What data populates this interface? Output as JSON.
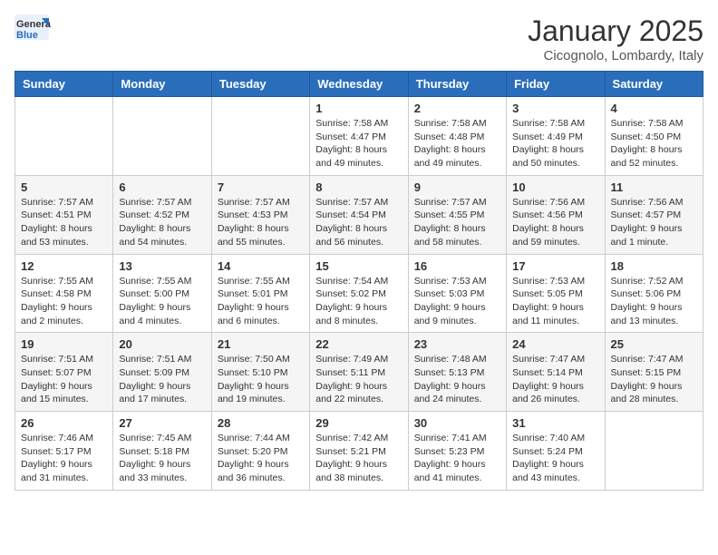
{
  "header": {
    "logo_general": "General",
    "logo_blue": "Blue",
    "month": "January 2025",
    "location": "Cicognolo, Lombardy, Italy"
  },
  "days_of_week": [
    "Sunday",
    "Monday",
    "Tuesday",
    "Wednesday",
    "Thursday",
    "Friday",
    "Saturday"
  ],
  "weeks": [
    [
      {
        "day": "",
        "info": ""
      },
      {
        "day": "",
        "info": ""
      },
      {
        "day": "",
        "info": ""
      },
      {
        "day": "1",
        "info": "Sunrise: 7:58 AM\nSunset: 4:47 PM\nDaylight: 8 hours\nand 49 minutes."
      },
      {
        "day": "2",
        "info": "Sunrise: 7:58 AM\nSunset: 4:48 PM\nDaylight: 8 hours\nand 49 minutes."
      },
      {
        "day": "3",
        "info": "Sunrise: 7:58 AM\nSunset: 4:49 PM\nDaylight: 8 hours\nand 50 minutes."
      },
      {
        "day": "4",
        "info": "Sunrise: 7:58 AM\nSunset: 4:50 PM\nDaylight: 8 hours\nand 52 minutes."
      }
    ],
    [
      {
        "day": "5",
        "info": "Sunrise: 7:57 AM\nSunset: 4:51 PM\nDaylight: 8 hours\nand 53 minutes."
      },
      {
        "day": "6",
        "info": "Sunrise: 7:57 AM\nSunset: 4:52 PM\nDaylight: 8 hours\nand 54 minutes."
      },
      {
        "day": "7",
        "info": "Sunrise: 7:57 AM\nSunset: 4:53 PM\nDaylight: 8 hours\nand 55 minutes."
      },
      {
        "day": "8",
        "info": "Sunrise: 7:57 AM\nSunset: 4:54 PM\nDaylight: 8 hours\nand 56 minutes."
      },
      {
        "day": "9",
        "info": "Sunrise: 7:57 AM\nSunset: 4:55 PM\nDaylight: 8 hours\nand 58 minutes."
      },
      {
        "day": "10",
        "info": "Sunrise: 7:56 AM\nSunset: 4:56 PM\nDaylight: 8 hours\nand 59 minutes."
      },
      {
        "day": "11",
        "info": "Sunrise: 7:56 AM\nSunset: 4:57 PM\nDaylight: 9 hours\nand 1 minute."
      }
    ],
    [
      {
        "day": "12",
        "info": "Sunrise: 7:55 AM\nSunset: 4:58 PM\nDaylight: 9 hours\nand 2 minutes."
      },
      {
        "day": "13",
        "info": "Sunrise: 7:55 AM\nSunset: 5:00 PM\nDaylight: 9 hours\nand 4 minutes."
      },
      {
        "day": "14",
        "info": "Sunrise: 7:55 AM\nSunset: 5:01 PM\nDaylight: 9 hours\nand 6 minutes."
      },
      {
        "day": "15",
        "info": "Sunrise: 7:54 AM\nSunset: 5:02 PM\nDaylight: 9 hours\nand 8 minutes."
      },
      {
        "day": "16",
        "info": "Sunrise: 7:53 AM\nSunset: 5:03 PM\nDaylight: 9 hours\nand 9 minutes."
      },
      {
        "day": "17",
        "info": "Sunrise: 7:53 AM\nSunset: 5:05 PM\nDaylight: 9 hours\nand 11 minutes."
      },
      {
        "day": "18",
        "info": "Sunrise: 7:52 AM\nSunset: 5:06 PM\nDaylight: 9 hours\nand 13 minutes."
      }
    ],
    [
      {
        "day": "19",
        "info": "Sunrise: 7:51 AM\nSunset: 5:07 PM\nDaylight: 9 hours\nand 15 minutes."
      },
      {
        "day": "20",
        "info": "Sunrise: 7:51 AM\nSunset: 5:09 PM\nDaylight: 9 hours\nand 17 minutes."
      },
      {
        "day": "21",
        "info": "Sunrise: 7:50 AM\nSunset: 5:10 PM\nDaylight: 9 hours\nand 19 minutes."
      },
      {
        "day": "22",
        "info": "Sunrise: 7:49 AM\nSunset: 5:11 PM\nDaylight: 9 hours\nand 22 minutes."
      },
      {
        "day": "23",
        "info": "Sunrise: 7:48 AM\nSunset: 5:13 PM\nDaylight: 9 hours\nand 24 minutes."
      },
      {
        "day": "24",
        "info": "Sunrise: 7:47 AM\nSunset: 5:14 PM\nDaylight: 9 hours\nand 26 minutes."
      },
      {
        "day": "25",
        "info": "Sunrise: 7:47 AM\nSunset: 5:15 PM\nDaylight: 9 hours\nand 28 minutes."
      }
    ],
    [
      {
        "day": "26",
        "info": "Sunrise: 7:46 AM\nSunset: 5:17 PM\nDaylight: 9 hours\nand 31 minutes."
      },
      {
        "day": "27",
        "info": "Sunrise: 7:45 AM\nSunset: 5:18 PM\nDaylight: 9 hours\nand 33 minutes."
      },
      {
        "day": "28",
        "info": "Sunrise: 7:44 AM\nSunset: 5:20 PM\nDaylight: 9 hours\nand 36 minutes."
      },
      {
        "day": "29",
        "info": "Sunrise: 7:42 AM\nSunset: 5:21 PM\nDaylight: 9 hours\nand 38 minutes."
      },
      {
        "day": "30",
        "info": "Sunrise: 7:41 AM\nSunset: 5:23 PM\nDaylight: 9 hours\nand 41 minutes."
      },
      {
        "day": "31",
        "info": "Sunrise: 7:40 AM\nSunset: 5:24 PM\nDaylight: 9 hours\nand 43 minutes."
      },
      {
        "day": "",
        "info": ""
      }
    ]
  ]
}
